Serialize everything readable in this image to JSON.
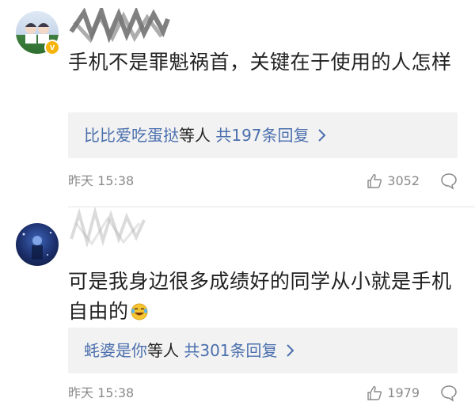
{
  "comments": [
    {
      "body": "手机不是罪魁祸首，关键在于使用的人怎样",
      "reply_users": "比比爱吃蛋挞",
      "reply_suffix": "等人",
      "reply_count": "共197条回复",
      "time": "昨天 15:38",
      "likes": "3052"
    },
    {
      "body": "可是我身边很多成绩好的同学从小就是手机自由的",
      "reply_users": "蚝婆是你",
      "reply_suffix": "等人",
      "reply_count": "共301条回复",
      "time": "昨天 15:38",
      "likes": "1979"
    }
  ],
  "icons": {
    "verified": "verified-badge-icon",
    "like": "thumbs-up-icon",
    "comment": "comment-bubble-icon",
    "chevron": "chevron-right-icon",
    "emoji": "laughing-crying-emoji"
  },
  "colors": {
    "link": "#4b6fae",
    "meta": "#8a8a8a",
    "reply_bg": "#f2f2f2",
    "badge": "#f6b40e"
  }
}
